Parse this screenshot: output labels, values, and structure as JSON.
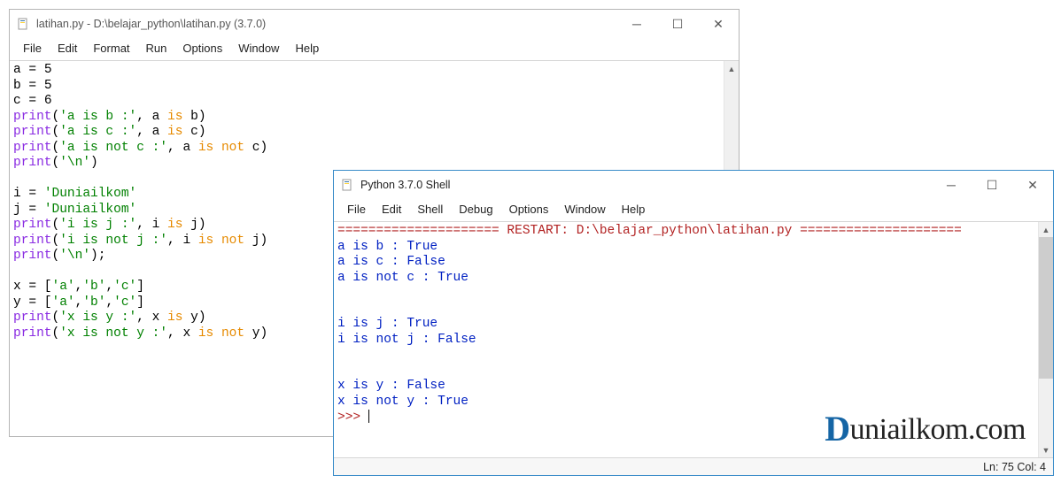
{
  "editor_window": {
    "title": "latihan.py - D:\\belajar_python\\latihan.py (3.7.0)",
    "menu": [
      "File",
      "Edit",
      "Format",
      "Run",
      "Options",
      "Window",
      "Help"
    ],
    "code": {
      "lines": [
        {
          "tokens": [
            [
              "",
              "a = "
            ],
            [
              "num",
              "5"
            ]
          ]
        },
        {
          "tokens": [
            [
              "",
              "b = "
            ],
            [
              "num",
              "5"
            ]
          ]
        },
        {
          "tokens": [
            [
              "",
              "c = "
            ],
            [
              "num",
              "6"
            ]
          ]
        },
        {
          "tokens": [
            [
              "builtin",
              "print"
            ],
            [
              "",
              "("
            ],
            [
              "str",
              "'a is b :'"
            ],
            [
              "",
              ", a "
            ],
            [
              "kw",
              "is"
            ],
            [
              "",
              " b)"
            ]
          ]
        },
        {
          "tokens": [
            [
              "builtin",
              "print"
            ],
            [
              "",
              "("
            ],
            [
              "str",
              "'a is c :'"
            ],
            [
              "",
              ", a "
            ],
            [
              "kw",
              "is"
            ],
            [
              "",
              " c)"
            ]
          ]
        },
        {
          "tokens": [
            [
              "builtin",
              "print"
            ],
            [
              "",
              "("
            ],
            [
              "str",
              "'a is not c :'"
            ],
            [
              "",
              ", a "
            ],
            [
              "kw",
              "is"
            ],
            [
              "",
              " "
            ],
            [
              "kw",
              "not"
            ],
            [
              "",
              " c)"
            ]
          ]
        },
        {
          "tokens": [
            [
              "builtin",
              "print"
            ],
            [
              "",
              "("
            ],
            [
              "str",
              "'\\n'"
            ],
            [
              "",
              ")"
            ]
          ]
        },
        {
          "tokens": [
            [
              "",
              ""
            ]
          ]
        },
        {
          "tokens": [
            [
              "",
              "i = "
            ],
            [
              "str",
              "'Duniailkom'"
            ]
          ]
        },
        {
          "tokens": [
            [
              "",
              "j = "
            ],
            [
              "str",
              "'Duniailkom'"
            ]
          ]
        },
        {
          "tokens": [
            [
              "builtin",
              "print"
            ],
            [
              "",
              "("
            ],
            [
              "str",
              "'i is j :'"
            ],
            [
              "",
              ", i "
            ],
            [
              "kw",
              "is"
            ],
            [
              "",
              " j)"
            ]
          ]
        },
        {
          "tokens": [
            [
              "builtin",
              "print"
            ],
            [
              "",
              "("
            ],
            [
              "str",
              "'i is not j :'"
            ],
            [
              "",
              ", i "
            ],
            [
              "kw",
              "is"
            ],
            [
              "",
              " "
            ],
            [
              "kw",
              "not"
            ],
            [
              "",
              " j)"
            ]
          ]
        },
        {
          "tokens": [
            [
              "builtin",
              "print"
            ],
            [
              "",
              "("
            ],
            [
              "str",
              "'\\n'"
            ],
            [
              "",
              ");"
            ]
          ]
        },
        {
          "tokens": [
            [
              "",
              ""
            ]
          ]
        },
        {
          "tokens": [
            [
              "",
              "x = ["
            ],
            [
              "str",
              "'a'"
            ],
            [
              "",
              ","
            ],
            [
              "str",
              "'b'"
            ],
            [
              "",
              ","
            ],
            [
              "str",
              "'c'"
            ],
            [
              "",
              "]"
            ]
          ]
        },
        {
          "tokens": [
            [
              "",
              "y = ["
            ],
            [
              "str",
              "'a'"
            ],
            [
              "",
              ","
            ],
            [
              "str",
              "'b'"
            ],
            [
              "",
              ","
            ],
            [
              "str",
              "'c'"
            ],
            [
              "",
              "]"
            ]
          ]
        },
        {
          "tokens": [
            [
              "builtin",
              "print"
            ],
            [
              "",
              "("
            ],
            [
              "str",
              "'x is y :'"
            ],
            [
              "",
              ", x "
            ],
            [
              "kw",
              "is"
            ],
            [
              "",
              " y)"
            ]
          ]
        },
        {
          "tokens": [
            [
              "builtin",
              "print"
            ],
            [
              "",
              "("
            ],
            [
              "str",
              "'x is not y :'"
            ],
            [
              "",
              ", x "
            ],
            [
              "kw",
              "is"
            ],
            [
              "",
              " "
            ],
            [
              "kw",
              "not"
            ],
            [
              "",
              " y)"
            ]
          ]
        }
      ]
    }
  },
  "shell_window": {
    "title": "Python 3.7.0 Shell",
    "menu": [
      "File",
      "Edit",
      "Shell",
      "Debug",
      "Options",
      "Window",
      "Help"
    ],
    "restart_line": "===================== RESTART: D:\\belajar_python\\latihan.py =====================",
    "output": [
      "a is b : True",
      "a is c : False",
      "a is not c : True",
      "",
      "",
      "i is j : True",
      "i is not j : False",
      "",
      "",
      "x is y : False",
      "x is not y : True"
    ],
    "prompt": ">>> ",
    "status": "Ln: 75  Col: 4"
  },
  "watermark": {
    "brand": "D",
    "rest": "uniailkom.com"
  }
}
